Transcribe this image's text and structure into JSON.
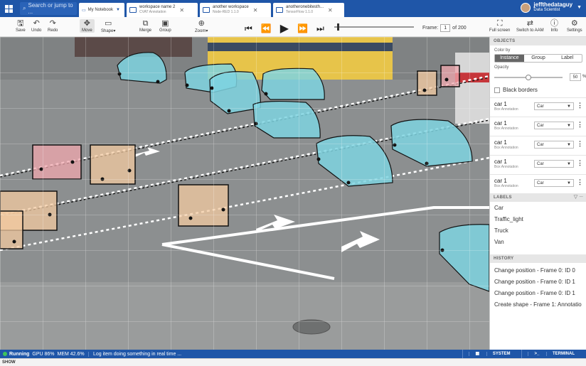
{
  "topbar": {
    "search_placeholder": "Search or jump to ...",
    "tabs": [
      {
        "title": "My Notebook",
        "sub": ""
      },
      {
        "title": "workspace name 2",
        "sub": "CVAT Annotation"
      },
      {
        "title": "another workspace",
        "sub": "Node-RED 1.1.0"
      },
      {
        "title": "anotheronebitesth...",
        "sub": "TensorFlow 1.1.0"
      }
    ],
    "user": {
      "name": "jeffthedataguy",
      "role": "Data Scientist"
    }
  },
  "toolbar": {
    "save": "Save",
    "undo": "Undo",
    "redo": "Redo",
    "move": "Move",
    "shape": "Shape",
    "merge": "Merge",
    "group": "Group",
    "zoom": "Zoom",
    "frame_label": "Frame:",
    "frame_value": "1",
    "frame_total": "of 200",
    "fullscreen": "Full screen",
    "switch_aam": "Switch to AAM",
    "info": "Info",
    "settings": "Settings"
  },
  "sidebar": {
    "objects_header": "OBJECTS",
    "color_by": "Color by",
    "color_options": [
      "Instance",
      "Group",
      "Label"
    ],
    "opacity_label": "Opacity",
    "opacity_value": 50,
    "opacity_value_text": "50",
    "opacity_unit": "%",
    "black_borders": "Black borders",
    "objects": [
      {
        "name": "car 1",
        "type": "Box Annotation",
        "label": "Car"
      },
      {
        "name": "car 1",
        "type": "Box Annotation",
        "label": "Car"
      },
      {
        "name": "car 1",
        "type": "Box Annotation",
        "label": "Car"
      },
      {
        "name": "car 1",
        "type": "Box Annotation",
        "label": "Car"
      },
      {
        "name": "car 1",
        "type": "Box Annotation",
        "label": "Car"
      }
    ],
    "labels_header": "LABELS",
    "labels": [
      "Car",
      "Traffic_light",
      "Truck",
      "Van"
    ],
    "history_header": "HISTORY",
    "history": [
      "Change position - Frame 0: ID 0",
      "Change position - Frame 0: ID 1",
      "Change position - Frame 0: ID 1",
      "Create shape - Frame 1: Annotatio"
    ]
  },
  "statusbar": {
    "state": "Running",
    "gpu": "GPU 86%",
    "mem": "MEM 42.6%",
    "log": "Log item doing something in real time ...",
    "system": "SYSTEM",
    "terminal": "TERMINAL",
    "show": "SHOW"
  },
  "colors": {
    "accent": "#1f56a8",
    "car_fill": "#7ed3e0",
    "person_fill": "#f3c9a0",
    "cyclist_fill": "#f0a7ae"
  }
}
